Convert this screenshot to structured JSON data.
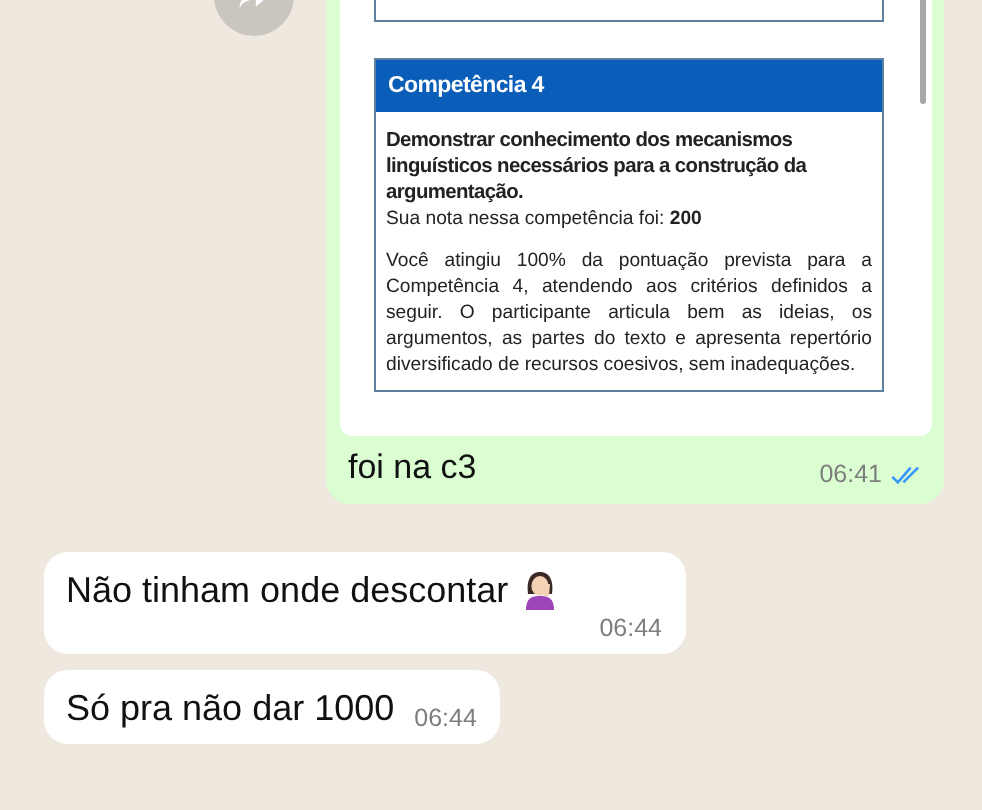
{
  "messages": [
    {
      "kind": "image",
      "outgoing": true,
      "document": {
        "header": "Competência 4",
        "title": "Demonstrar conhecimento dos mecanismos linguísticos necessários para a construção da argumentação.",
        "score_line": "Sua nota nessa competência foi: **200**",
        "body": "Você atingiu 100% da pontuação prevista para a Competência 4, atendendo aos critérios definidos a seguir. O participante articula bem as ideias, os argumentos, as partes do texto e apresenta repertório diversificado de recursos coesivos, sem inadequações."
      },
      "caption": "foi na c3",
      "time": "06:41",
      "read": true
    },
    {
      "kind": "text",
      "outgoing": false,
      "text": "Não tinham onde descontar",
      "has_emoji": true,
      "time": "06:44"
    },
    {
      "kind": "text",
      "outgoing": false,
      "text": "Só pra não dar 1000",
      "time": "06:44"
    }
  ]
}
